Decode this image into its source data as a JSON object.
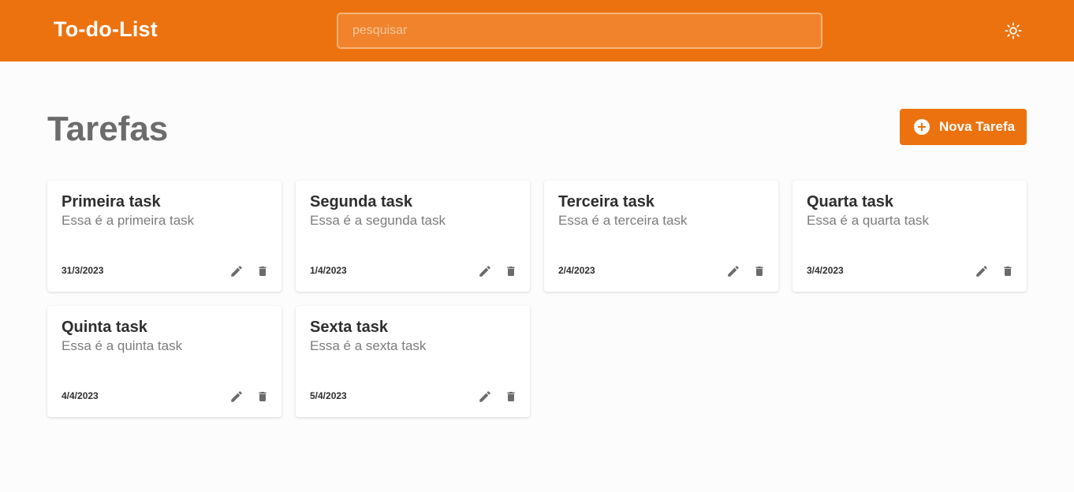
{
  "header": {
    "title": "To-do-List",
    "search_placeholder": "pesquisar",
    "search_value": "",
    "theme_icon": "sun-icon"
  },
  "main": {
    "title": "Tarefas",
    "new_task_label": "Nova Tarefa",
    "new_task_icon": "plus-circle-icon"
  },
  "tasks": [
    {
      "title": "Primeira task",
      "description": "Essa é a primeira task",
      "date": "31/3/2023"
    },
    {
      "title": "Segunda task",
      "description": "Essa é a segunda task",
      "date": "1/4/2023"
    },
    {
      "title": "Terceira task",
      "description": "Essa é a terceira task",
      "date": "2/4/2023"
    },
    {
      "title": "Quarta task",
      "description": "Essa é a quarta task",
      "date": "3/4/2023"
    },
    {
      "title": "Quinta task",
      "description": "Essa é a quinta task",
      "date": "4/4/2023"
    },
    {
      "title": "Sexta task",
      "description": "Essa é a sexta task",
      "date": "5/4/2023"
    }
  ],
  "task_actions": {
    "edit_icon": "pencil-icon",
    "delete_icon": "trash-icon"
  },
  "colors": {
    "primary": "#ec720f",
    "background": "#fcfcfc",
    "icon": "#6b6b6b"
  }
}
